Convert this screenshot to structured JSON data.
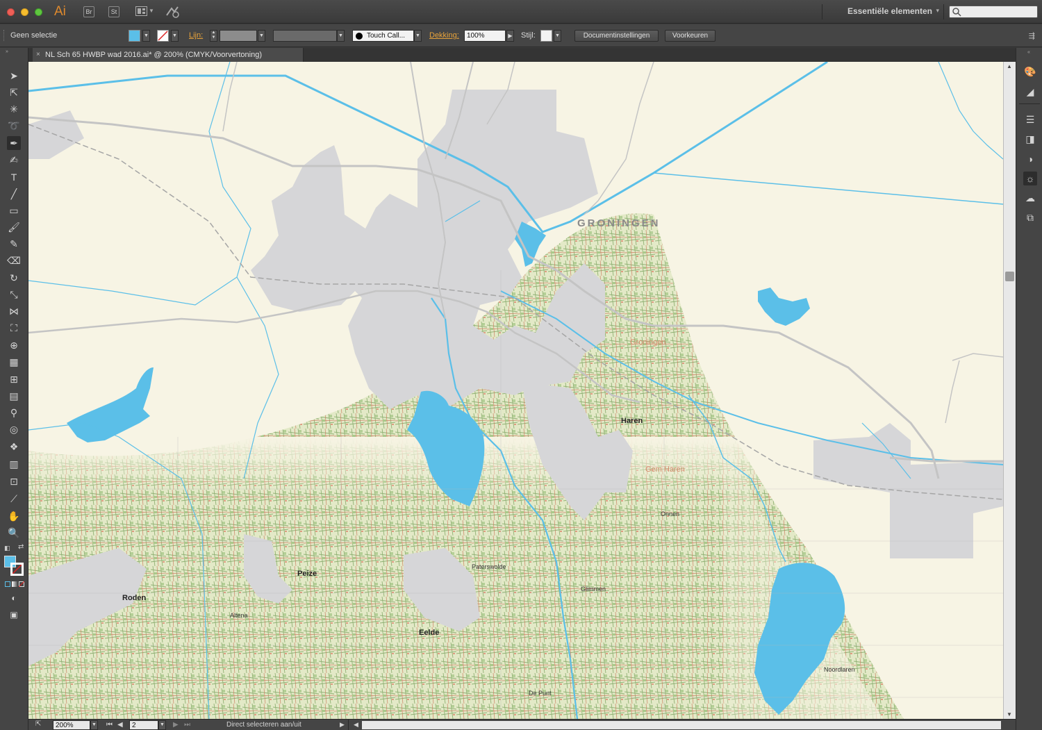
{
  "app": {
    "logo": "Ai",
    "bridge_label": "Br",
    "stock_label": "St",
    "workspace": "Essentiële elementen",
    "search_placeholder": ""
  },
  "control_bar": {
    "selection_label": "Geen selectie",
    "stroke_label": "Lijn:",
    "brush_label": "Touch Call...",
    "opacity_label": "Dekking:",
    "opacity_value": "100%",
    "style_label": "Stijl:",
    "doc_settings_button": "Documentinstellingen",
    "preferences_button": "Voorkeuren"
  },
  "document_tab": {
    "close": "×",
    "title": "NL Sch 65 HWBP  wad 2016.ai* @ 200% (CMYK/Voorvertoning)"
  },
  "status_bar": {
    "zoom": "200%",
    "page": "2",
    "status_text": "Direct selecteren aan/uit"
  },
  "map_labels": {
    "groningen_big": "GRONINGEN",
    "groningen_small": "Groningen",
    "haren": "Haren",
    "roden": "Roden",
    "peize": "Peize",
    "eelde": "Eelde",
    "paterswolde": "Paterswolde",
    "glimmen": "Glimmen",
    "onnen": "Onnen",
    "noordlaren": "Noordlaren",
    "gem_haren": "Gem Haren",
    "altena": "Altena",
    "depunt": "De Punt"
  },
  "colors": {
    "water": "#5bbfe8",
    "urban": "#d6d6d8",
    "land": "#f7f4e4",
    "topo_green": "#c9d9a8",
    "accent_orange": "#e8a33a"
  }
}
